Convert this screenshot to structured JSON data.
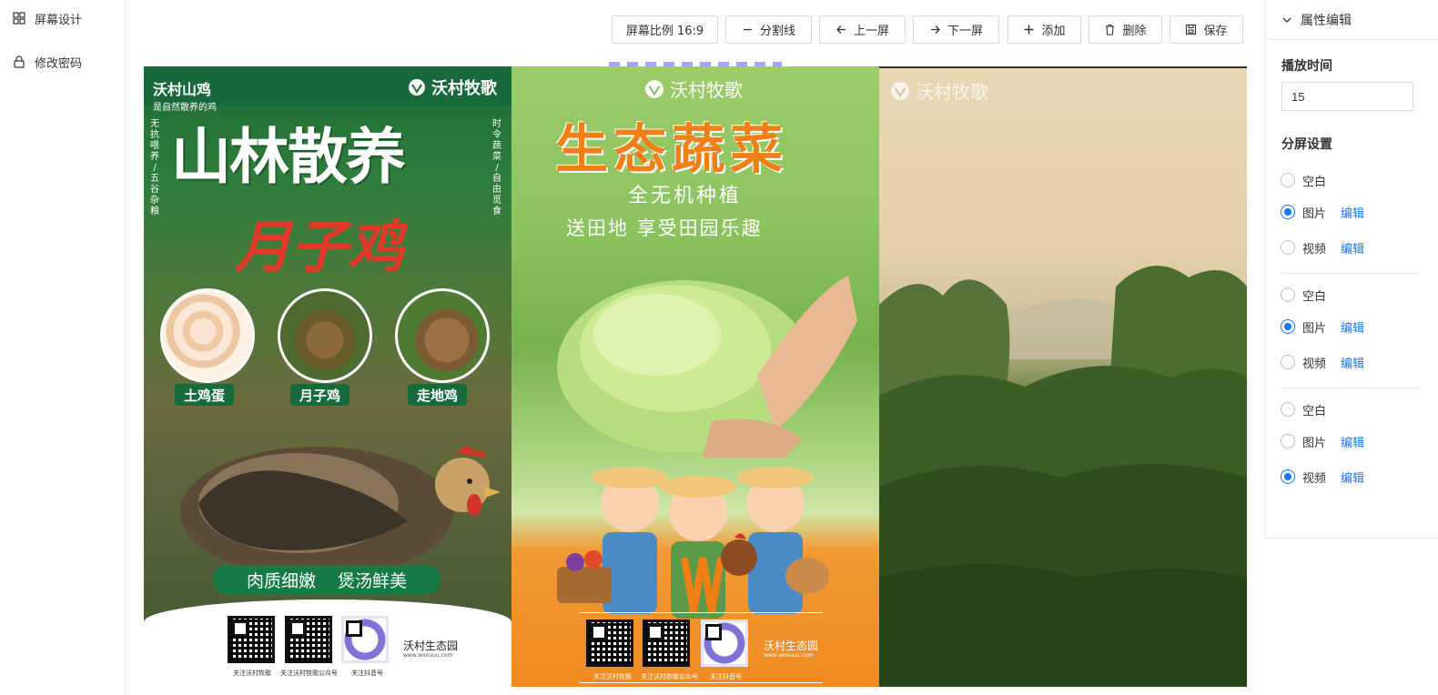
{
  "sidebar": {
    "items": [
      {
        "label": "屏幕设计",
        "icon": "grid-icon"
      },
      {
        "label": "修改密码",
        "icon": "lock-icon"
      }
    ]
  },
  "toolbar": {
    "ratio_label": "屏幕比例 16:9",
    "divider_label": "分割线",
    "prev_label": "上一屏",
    "next_label": "下一屏",
    "add_label": "添加",
    "delete_label": "删除",
    "save_label": "保存"
  },
  "screens": {
    "chicken": {
      "brand_left": "沃村山鸡",
      "sub_left": "是自然散养的鸡",
      "brand_right": "沃村牧歌",
      "side_left": "无抗喂养 / 五谷杂粮",
      "side_right": "时令蔬菜 / 自由觅食",
      "headline": "山林散养",
      "headline2": "月子鸡",
      "tags": [
        "土鸡蛋",
        "月子鸡",
        "走地鸡"
      ],
      "slogan_1": "肉质细嫩",
      "slogan_2": "煲汤鲜美",
      "qr_captions": [
        "关注沃村牧歌",
        "关注沃村牧歌公众号",
        "关注抖音号"
      ],
      "footer_brand": "沃村生态园",
      "footer_url": "www.woouuu.com"
    },
    "veggie": {
      "brand": "沃村牧歌",
      "headline": "生态蔬菜",
      "line1": "全无机种植",
      "line2": "送田地 享受田园乐趣",
      "qr_captions": [
        "关注沃村牧歌",
        "关注沃村牧歌公众号",
        "关注抖音号"
      ],
      "footer_brand": "沃村生态园",
      "footer_url": "www.woouuu.com"
    },
    "forest": {
      "brand": "沃村牧歌"
    }
  },
  "properties": {
    "title": "属性编辑",
    "duration_label": "播放时间",
    "duration_value": "15",
    "split_label": "分屏设置",
    "edit_label": "编辑",
    "groups": [
      {
        "options": [
          "空白",
          "图片",
          "视频"
        ],
        "selected": "图片"
      },
      {
        "options": [
          "空白",
          "图片",
          "视频"
        ],
        "selected": "图片"
      },
      {
        "options": [
          "空白",
          "图片",
          "视频"
        ],
        "selected": "视频"
      }
    ]
  },
  "colors": {
    "accent": "#1677ff",
    "brand_green": "#17683a",
    "veggie_orange": "#f07f15"
  }
}
